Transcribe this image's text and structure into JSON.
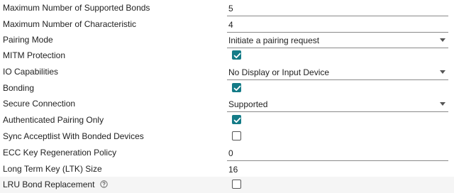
{
  "fields": [
    {
      "label": "Maximum Number of Supported Bonds",
      "type": "text",
      "value": "5"
    },
    {
      "label": "Maximum Number of Characteristic",
      "type": "text",
      "value": "4"
    },
    {
      "label": "Pairing Mode",
      "type": "select",
      "value": "Initiate a pairing request"
    },
    {
      "label": "MITM Protection",
      "type": "checkbox",
      "checked": true
    },
    {
      "label": "IO Capabilities",
      "type": "select",
      "value": "No Display or Input Device"
    },
    {
      "label": "Bonding",
      "type": "checkbox",
      "checked": true
    },
    {
      "label": "Secure Connection",
      "type": "select",
      "value": "Supported"
    },
    {
      "label": "Authenticated Pairing Only",
      "type": "checkbox",
      "checked": true
    },
    {
      "label": "Sync Acceptlist With Bonded Devices",
      "type": "checkbox",
      "checked": false
    },
    {
      "label": "ECC Key Regeneration Policy",
      "type": "text",
      "value": "0"
    },
    {
      "label": "Long Term Key (LTK) Size",
      "type": "text",
      "value": "16"
    },
    {
      "label": "LRU Bond Replacement",
      "type": "checkbox",
      "checked": false,
      "help_icon": "question-circle-icon"
    }
  ],
  "colors": {
    "checkbox_checked": "#147b87",
    "row_highlight": "#f5f5f5"
  }
}
